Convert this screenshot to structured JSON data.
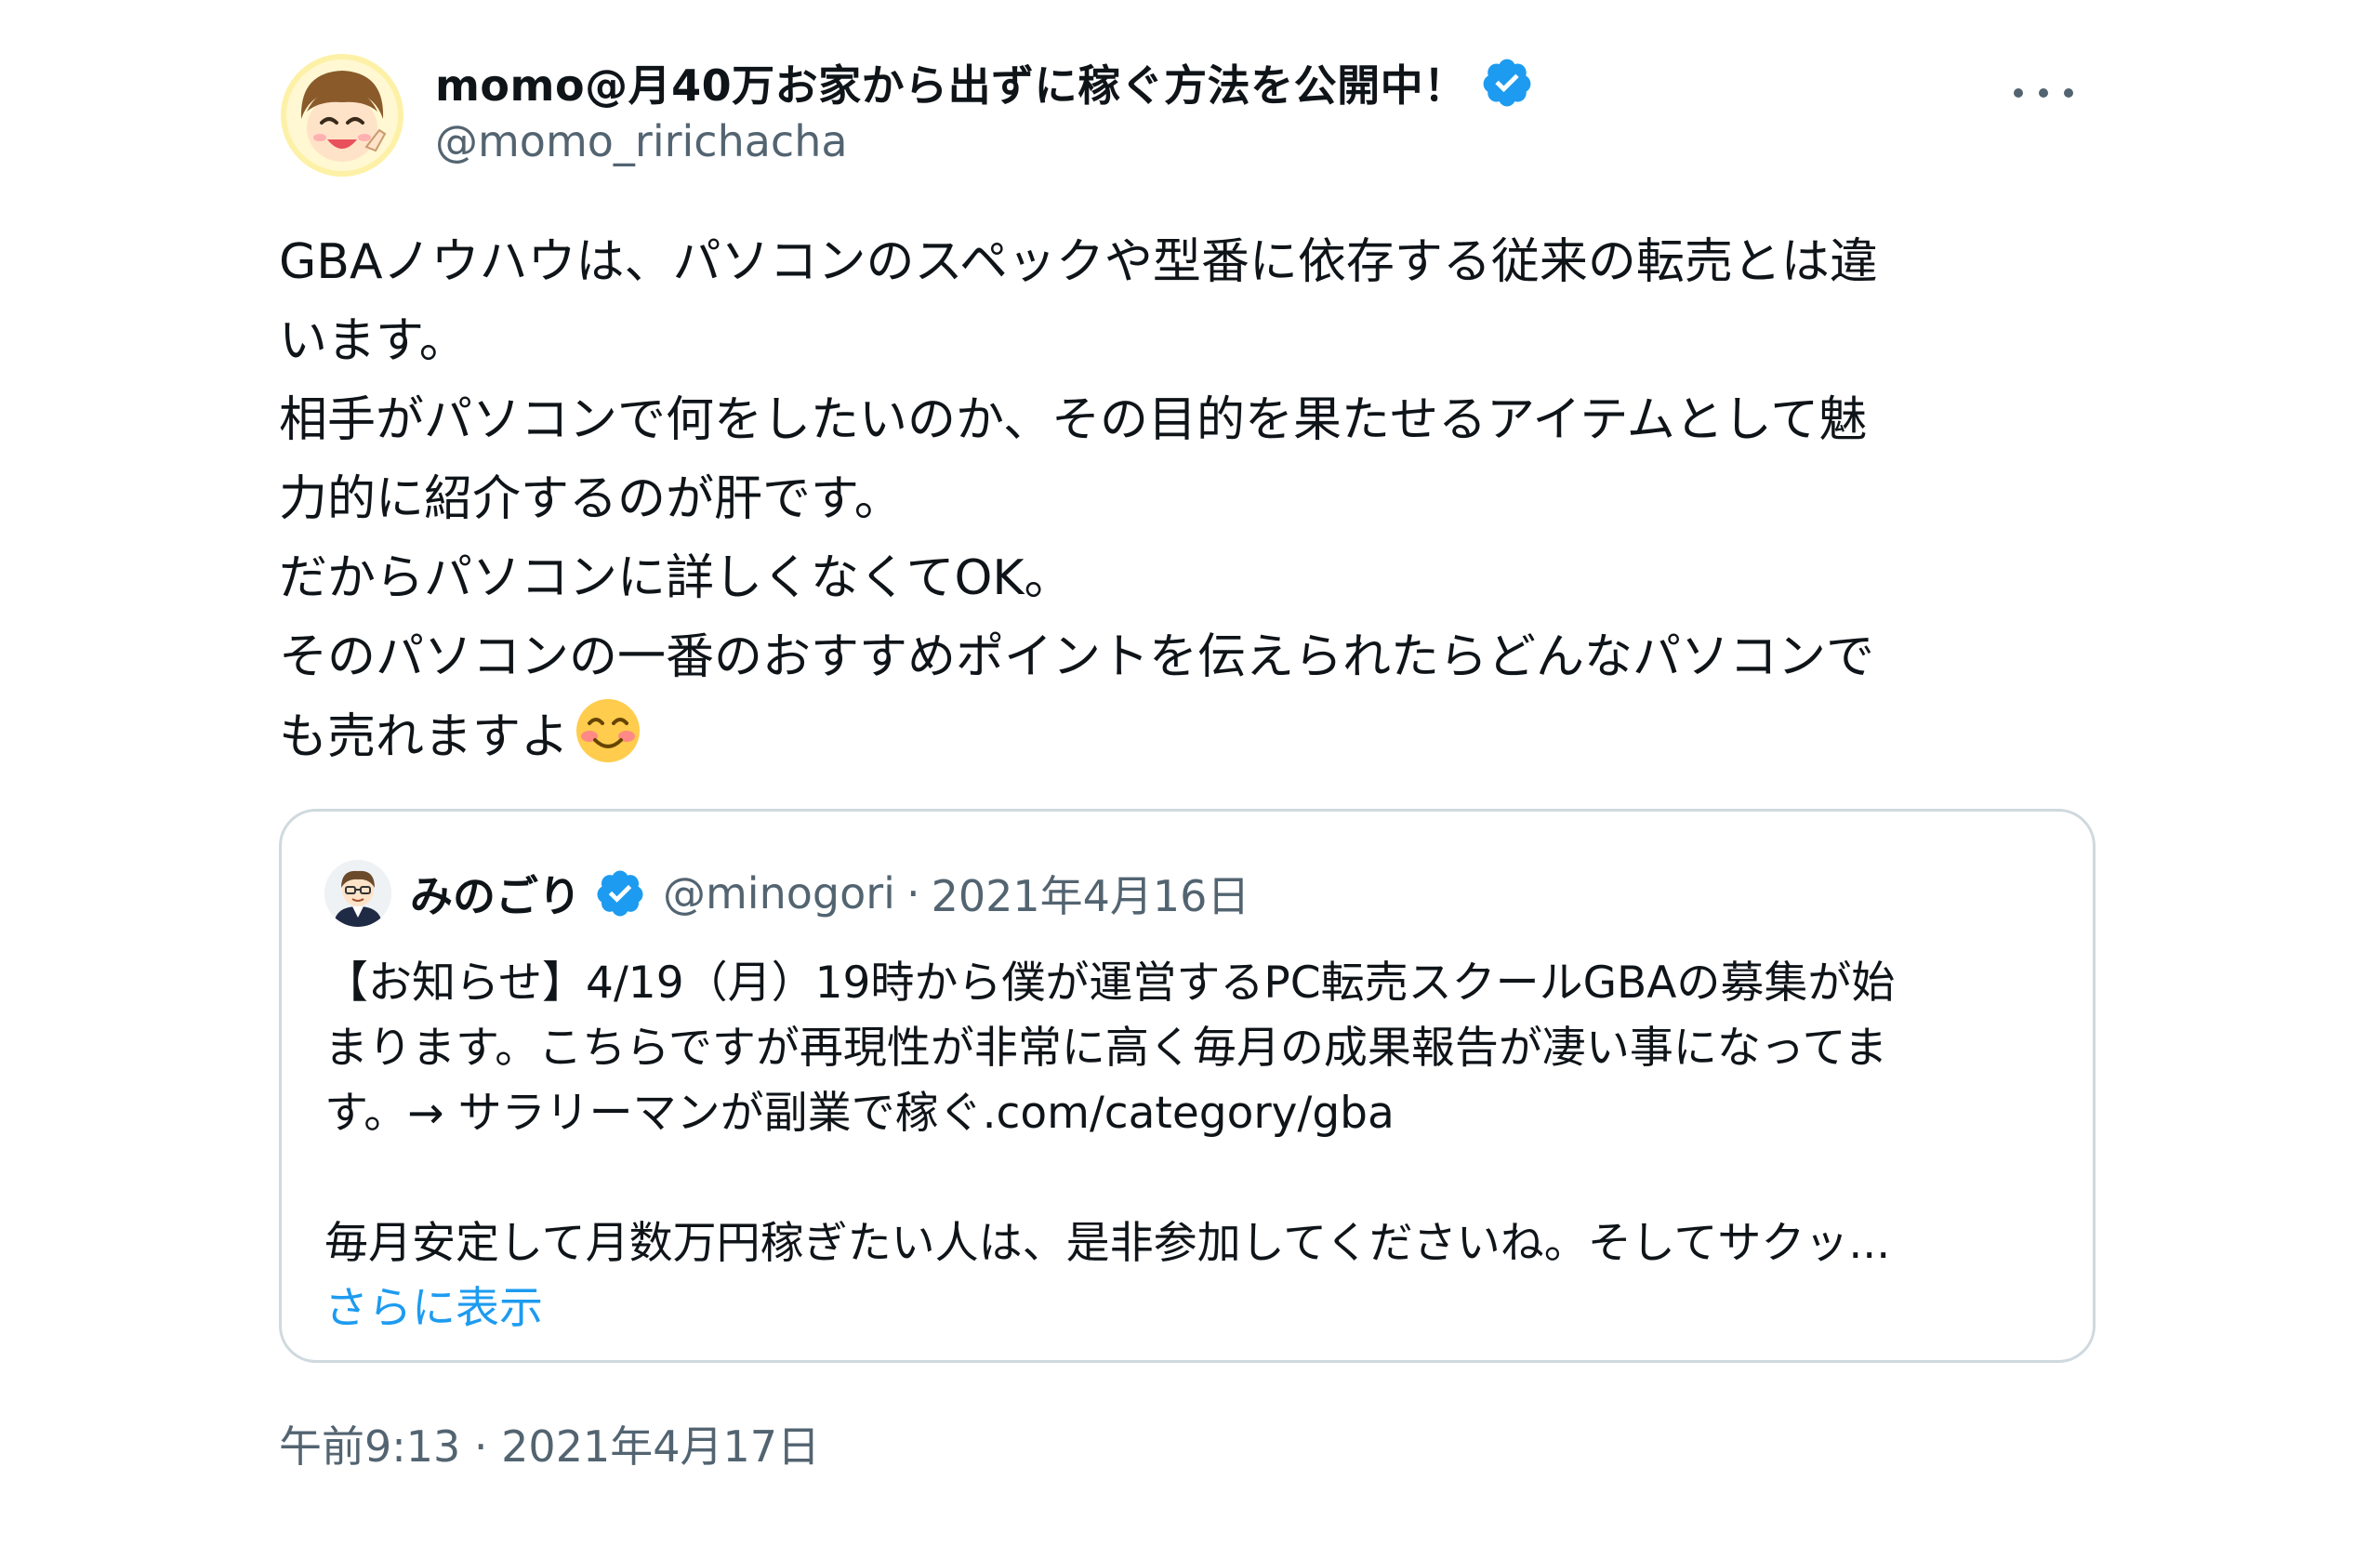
{
  "tweet": {
    "display_name": "momo@月40万お家から出ずに稼ぐ方法を公開中！",
    "handle": "@momo_ririchacha",
    "body_lines": [
      "GBAノウハウは、パソコンのスペックや型番に依存する従来の転売とは違",
      "います。",
      "相手がパソコンで何をしたいのか、その目的を果たせるアイテムとして魅",
      "力的に紹介するのが肝です。",
      "だからパソコンに詳しくなくてOK。",
      "そのパソコンの一番のおすすめポイントを伝えられたらどんなパソコンで",
      "も売れますよ"
    ],
    "emoji": "smiling-face-with-smiling-eyes-icon",
    "timestamp": "午前9:13 · 2021年4月17日"
  },
  "quote": {
    "display_name": "みのごり",
    "handle": "@minogori",
    "separator": "·",
    "date": "2021年4月16日",
    "text_lines": [
      "【お知らせ】4/19（月）19時から僕が運営するPC転売スクールGBAの募集が始",
      "まります。こちらですが再現性が非常に高く毎月の成果報告が凄い事になってま",
      "す。→ サラリーマンが副業で稼ぐ.com/category/gba",
      "",
      "毎月安定して月数万円稼ぎたい人は、是非参加してくださいね。そしてサクッ..."
    ],
    "show_more": "さらに表示"
  },
  "colors": {
    "text": "#0f1419",
    "secondary": "#536471",
    "link": "#1d9bf0",
    "verified": "#1d9bf0",
    "border": "#cfd9de"
  }
}
